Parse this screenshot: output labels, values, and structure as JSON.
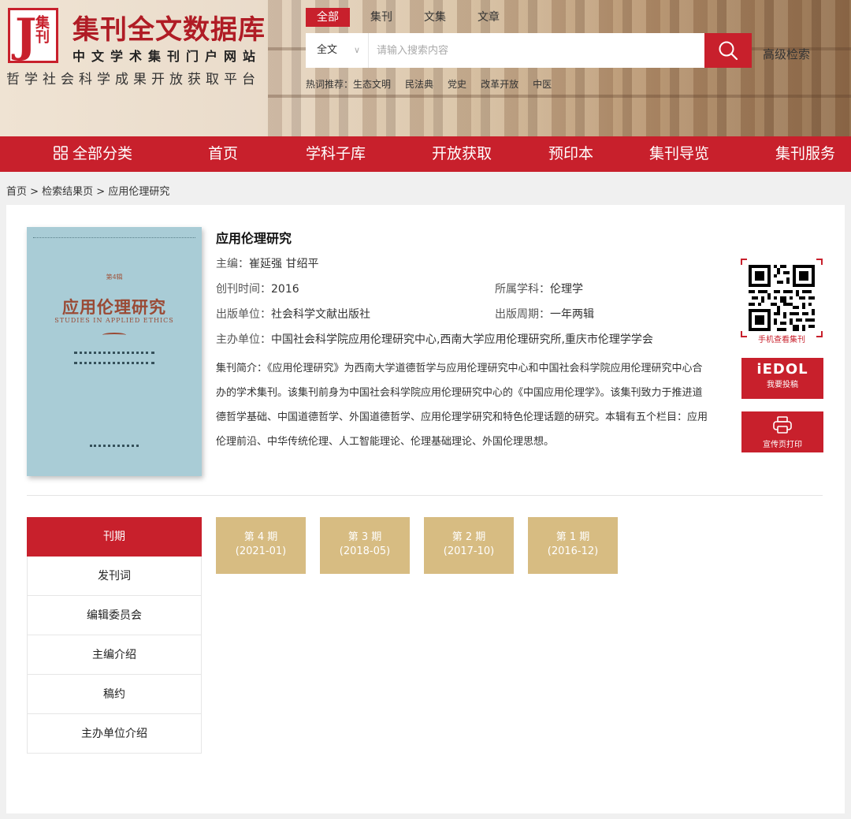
{
  "brand": {
    "logo_j": "J",
    "logo_text": "集刊",
    "title": "集刊全文数据库",
    "subtitle": "中文学术集刊门户网站",
    "slogan": "哲学社会科学成果开放获取平台"
  },
  "search": {
    "tabs": [
      "全部",
      "集刊",
      "文集",
      "文章"
    ],
    "active_tab": "全部",
    "scope": "全文",
    "placeholder": "请输入搜索内容",
    "advanced_label": "高级检索",
    "hot_label": "热词推荐：",
    "hot_words": [
      "生态文明",
      "民法典",
      "党史",
      "改革开放",
      "中医"
    ]
  },
  "nav": {
    "items": [
      "全部分类",
      "首页",
      "学科子库",
      "开放获取",
      "预印本",
      "集刊导览",
      "集刊服务"
    ]
  },
  "breadcrumb": "首页 > 检索结果页 > 应用伦理研究",
  "journal": {
    "title": "应用伦理研究",
    "chief_editor_label": "主编：",
    "chief_editor": "崔延强 甘绍平",
    "founded_label": "创刊时间：",
    "founded": "2016",
    "subject_label": "所属学科：",
    "subject": "伦理学",
    "publisher_label": "出版单位：",
    "publisher": "社会科学文献出版社",
    "cycle_label": "出版周期：",
    "cycle": "一年两辑",
    "sponsor_label": "主办单位：",
    "sponsor": "中国社会科学院应用伦理研究中心,西南大学应用伦理研究所,重庆市伦理学学会",
    "intro_label": "集刊简介：",
    "intro": "《应用伦理研究》为西南大学道德哲学与应用伦理研究中心和中国社会科学院应用伦理研究中心合办的学术集刊。该集刊前身为中国社会科学院应用伦理研究中心的《中国应用伦理学》。该集刊致力于推进道德哲学基础、中国道德哲学、外国道德哲学、应用伦理学研究和特色伦理话题的研究。本辑有五个栏目：应用伦理前沿、中华传统伦理、人工智能理论、伦理基础理论、外国伦理思想。"
  },
  "cover": {
    "edition": "第4辑",
    "title": "应用伦理研究",
    "subtitle": "STUDIES IN APPLIED ETHICS"
  },
  "side_actions": {
    "qr_label": "手机查看集刊",
    "submit_logo": "iEDOL",
    "submit_label": "我要投稿",
    "print_label": "宣传页打印"
  },
  "side_menu": {
    "items": [
      "刊期",
      "发刊词",
      "编辑委员会",
      "主编介绍",
      "稿约",
      "主办单位介绍"
    ],
    "active": "刊期"
  },
  "issues": [
    {
      "label": "第 4 期",
      "date": "(2021-01)"
    },
    {
      "label": "第 3 期",
      "date": "(2018-05)"
    },
    {
      "label": "第 2 期",
      "date": "(2017-10)"
    },
    {
      "label": "第 1 期",
      "date": "(2016-12)"
    }
  ],
  "colors": {
    "accent": "#c8202c",
    "issue_tile": "#d7bc82"
  }
}
